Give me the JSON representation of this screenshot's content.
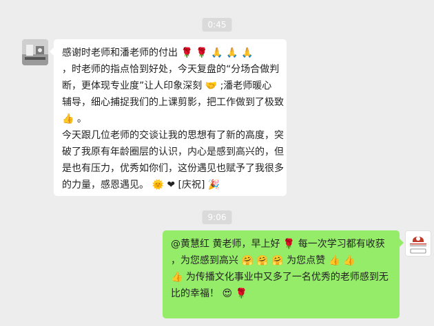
{
  "timestamps": [
    "0:45",
    "9:06"
  ],
  "message_1": {
    "lines": [
      "感谢时老师和潘老师的付出 🌹 🌹 🙏 🙏 🙏",
      "，时老师的指点恰到好处，今天复盘的“分场合做判",
      "断，更体现专业度”让人印象深刻 🤝 ;潘老师暖心",
      "辅导，细心捕捉我们的上课剪影，把工作做到了极致",
      "👍 。",
      "今天跟几位老师的交谈让我的思想有了新的高度，突",
      "破了我原有年龄圈层的认识，内心是感到高兴的，但",
      "是也有压力，优秀如你们，这份遇见也赋予了我很多",
      "的力量，感恩遇见。 🌞 ❤ [庆祝] 🎉"
    ]
  },
  "message_2": {
    "lines": [
      "@黄慧红 黄老师，早上好 🌹 每一次学习都有收获",
      "，为您感到高兴 🤗 🤗 🤗 为您点赞 👍 👍",
      "👍 为传播文化事业中又多了一名优秀的老师感到无",
      "比的幸福！ 😍 🌹"
    ]
  },
  "avatar_right": {
    "logo_text": "广州市文化协会",
    "label": "(专家人员)"
  }
}
